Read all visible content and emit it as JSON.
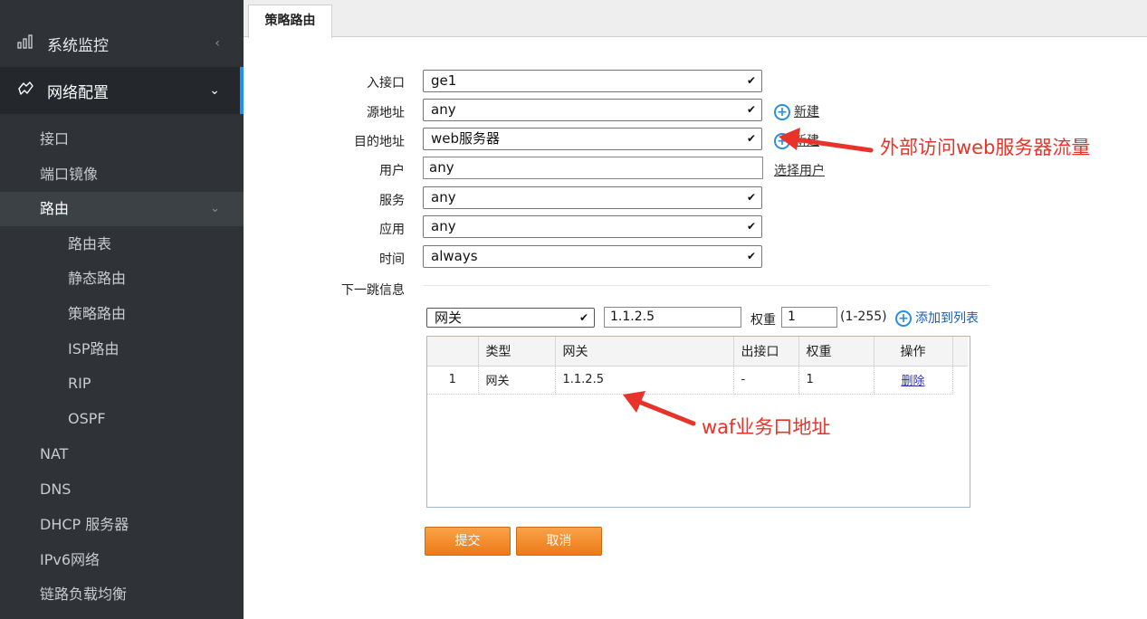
{
  "sidebar": {
    "monitor_label": "系统监控",
    "network_label": "网络配置",
    "items": [
      "接口",
      "端口镜像",
      "路由",
      "路由表",
      "静态路由",
      "策略路由",
      "ISP路由",
      "RIP",
      "OSPF",
      "NAT",
      "DNS",
      "DHCP 服务器",
      "IPv6网络",
      "链路负载均衡"
    ]
  },
  "tab": {
    "label": "策略路由"
  },
  "form": {
    "in_interface": {
      "label": "入接口",
      "value": "ge1"
    },
    "src_addr": {
      "label": "源地址",
      "value": "any"
    },
    "dst_addr": {
      "label": "目的地址",
      "value": "web服务器"
    },
    "user": {
      "label": "用户",
      "value": "any"
    },
    "service": {
      "label": "服务",
      "value": "any"
    },
    "app": {
      "label": "应用",
      "value": "any"
    },
    "time": {
      "label": "时间",
      "value": "always"
    },
    "new_link": "新建",
    "select_user_link": "选择用户",
    "nexthop_label": "下一跳信息",
    "nexthop_type": "网关",
    "nexthop_value": "1.1.2.5",
    "weight_label": "权重",
    "weight_value": "1",
    "weight_range": "(1-255)",
    "add_to_list": "添加到列表"
  },
  "table": {
    "headers": [
      "",
      "类型",
      "网关",
      "出接口",
      "权重",
      "操作"
    ],
    "rows": [
      {
        "index": "1",
        "type": "网关",
        "gateway": "1.1.2.5",
        "out_if": "-",
        "weight": "1",
        "action": "删除"
      }
    ]
  },
  "buttons": {
    "submit": "提交",
    "cancel": "取消"
  },
  "annotations": {
    "dst_note": "外部访问web服务器流量",
    "gw_note": "waf业务口地址"
  },
  "colors": {
    "accent": "#1e90ff",
    "button": "#ee7a18",
    "annotation": "#e8332a"
  }
}
